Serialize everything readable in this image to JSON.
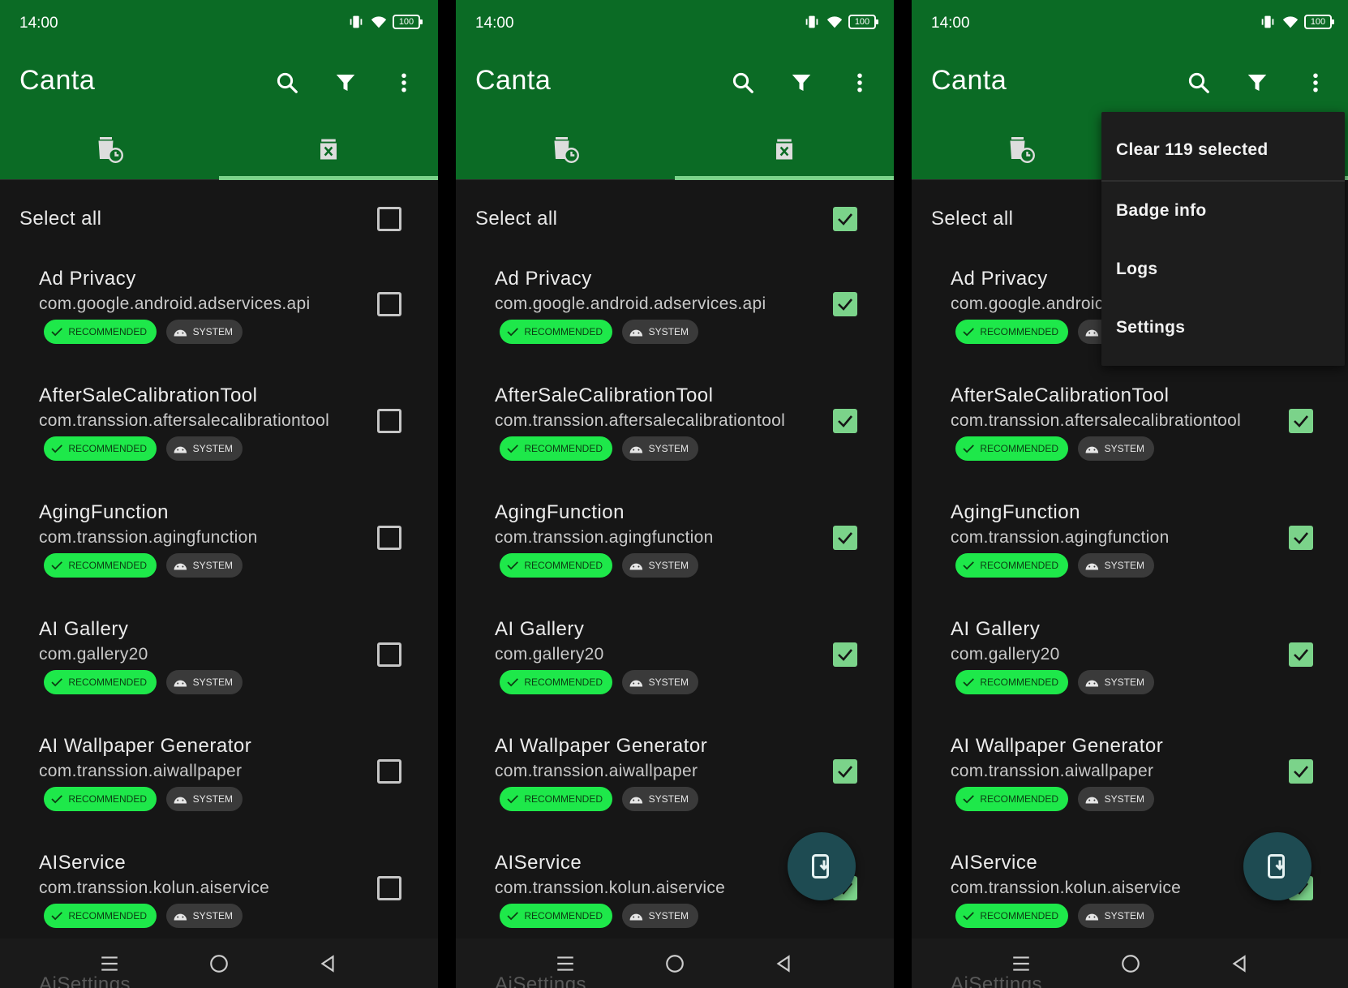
{
  "status": {
    "time": "14:00",
    "battery": "100"
  },
  "app": {
    "title": "Canta"
  },
  "colors": {
    "accent_green": "#0b6b25",
    "check_green": "#7bd38a",
    "recommended_badge": "#1ee84a",
    "fab": "#1e4b52"
  },
  "icons": {
    "search": "search-icon",
    "filter": "filter-icon",
    "more": "more-vert-icon",
    "tab_recent": "trash-clock-icon",
    "tab_uninstall": "trash-x-icon",
    "fab": "phone-download-icon",
    "badge_recommended": "check-icon",
    "badge_system": "android-icon"
  },
  "select_all_label": "Select all",
  "badges": {
    "recommended": "RECOMMENDED",
    "system": "SYSTEM"
  },
  "ghost_item": "AiSettings",
  "apps": [
    {
      "name": "Ad Privacy",
      "pkg": "com.google.android.adservices.api"
    },
    {
      "name": "AfterSaleCalibrationTool",
      "pkg": "com.transsion.aftersalecalibrationtool"
    },
    {
      "name": "AgingFunction",
      "pkg": "com.transsion.agingfunction"
    },
    {
      "name": "AI Gallery",
      "pkg": "com.gallery20"
    },
    {
      "name": "AI Wallpaper Generator",
      "pkg": "com.transsion.aiwallpaper"
    },
    {
      "name": "AIService",
      "pkg": "com.transsion.kolun.aiservice"
    }
  ],
  "screen3_pkg_truncated": "com.google.androic",
  "menu": {
    "clear_selected": "Clear 119 selected",
    "badge_info": "Badge info",
    "logs": "Logs",
    "settings": "Settings"
  }
}
